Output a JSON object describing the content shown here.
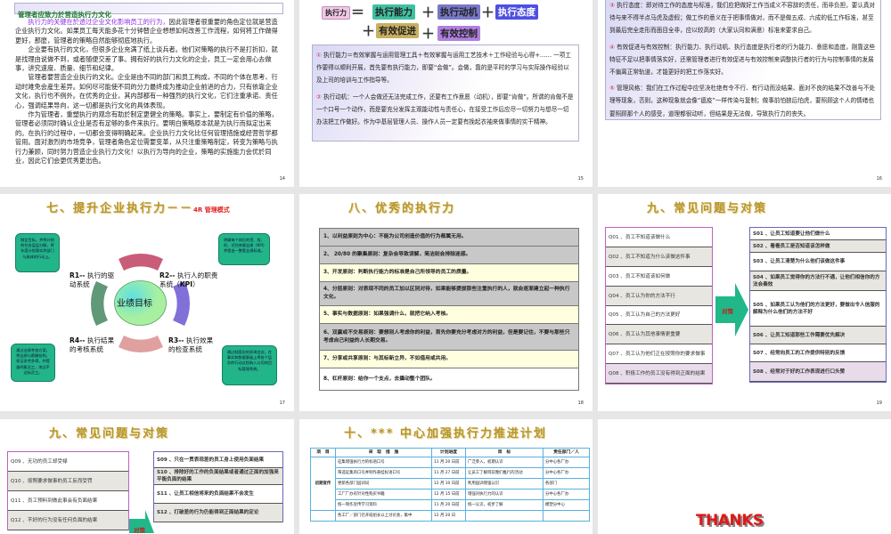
{
  "slides": {
    "s14": {
      "header": "管理者应致力於营造执行力文化",
      "p1_highlight": "执行力的关键在於透过企业文化影响员工的行为，",
      "p1_rest": "因此管理者很重要的角色定位就是营造企业执行力文化。如果员工每天能多花十分钟替企业想想如何改善工作流程，如何将工作做得更好，那麽，管理者的策略自然能够彻底地执行。",
      "p2": "企业要有执行的文化，但很多企业充满了纸上谈兵者。他们对策略的执行不是打折扣，就是找理由说做不到，或者随便交差了事。拥有好的执行力文化的企业，员工一定会用心去做事，讲究速度、质量、细节和纪律。",
      "p3": "管理者要营造企业执行的文化。企业是由不同的部门和员工构成，不同的个体在思考、行动时难免会産生差异。如何尽可能使不同的分力最终成为推动企业前进的合力，只有依靠企业文化，执行也不例外。在优秀的企业，其内部都有一种强烈的执行文化，它们注重承诺、责任心，强调结果导向，这一切都是执行文化的具体表现。",
      "p4": "作为管理者，重塑执行的观念有助於制定更健全的策略。事实上，要制定有价值的策略，管理者必须同时确认企业是否有足够的条件来执行。要明白策略原本就是为执行而拟定出来的。在执行的过程中，一切都会变得明确起来。企业执行力文化比任何管理措施或经营哲学都管用。面对激烈的市场竞争，管理者角色定位需要变革，从只注重策略制定，转变为策略与执行力兼顾，同时努力营造企业执行力文化！以执行为导向的企业，策略的实施能力会优於同业，因此它们会更优秀更出色。",
      "page": "14"
    },
    "s15": {
      "formula": {
        "lhs": "执行力",
        "eq": "＝",
        "plus": "＋",
        "terms": [
          "执行能力",
          "执行动机",
          "执行态度",
          "有效促进",
          "有效控制"
        ]
      },
      "items": [
        {
          "num": "①",
          "text": "执行能力＝有效掌握与运用管理工具＋有效掌握与运用工艺技术＋工作经验与心得+…… 一项工作要得以顺利开展，首先要有执行能力，即要“会做”。会做，靠的是平时的学习与实际操作经验以及上司的培训与工作指导等。"
        },
        {
          "num": "②",
          "text": "执行动机：一个人会做还无法完成工作，还要有工作意愿（动机），即要“肯做”。所谓的肯做不是一个口号一个动作，而是要充分发挥主观能动性与责任心，在接受工作后应尽一切努力与想尽一切办法把工作做好。作为中基层管理人员、操作人员一定要有挽起衣袖来做事情的实干精神。"
        }
      ],
      "page": "15"
    },
    "s16": {
      "items": [
        {
          "num": "③",
          "text": "执行态度：即对待工作的态度与标准，我们应把做好工作当成义不容辞的责任，而非负担，要认真对待与来不得半点马虎及虚假；做工作的意义在于把事情做对，而不是做五成、六成的低工作标准，甚至到最后完全走形而面目全非，应以较高的（大家认同和满意）标准来要求自己。"
        },
        {
          "num": "④",
          "text": "有效促进与有效控制：执行能力、执行动机、执行态度是执行者的行为能力、意愿和态度，刚靠这些特征不足以把事情落实好，还需管理者进行有效促进与有效控制来调整执行者的行为与控制事情的发展不偏离正常轨道，才能更好的把工作落实好。"
        },
        {
          "num": "⑤",
          "text": "管理风格：我们在工作过程中应坚决杜绝有令不行、有行动而没结果、面对不良的结果不改善与不处理等现象，否则，这种现象就会像“瘟疫”一样传染与复制；做事前怕狼后怕虎，要照顾这个人的情绪也要照顾那个人的感受，道理都很动听，但结果是无法做，导致执行力的丧失。"
        }
      ],
      "page": "16"
    },
    "s17": {
      "title": "七、提升企业执行力－－",
      "title_suffix": "4R 管理模式",
      "center": "业绩目标",
      "r1": {
        "code": "R1--",
        "label": " 执行的驱动系统",
        "note": "制定目标，并将计划的任务层层分解，将年度计划落实到部门与具体的行动上。"
      },
      "r2": {
        "code": "R2--",
        "label": " 执行人的职责系统（",
        "kpi": "KPI",
        "end": "）",
        "note": "明确每个岗位的责、权、利，识别关键业绩（KPI）并提出一整套业绩标准。"
      },
      "r3": {
        "code": "R3--",
        "label": " 执行效果的检查系统",
        "note": "通过制度化的质询会议，在事实和数据基础上将各个层次的行动过程纳入公司的目标管理系统。"
      },
      "r4": {
        "code": "R4--",
        "label": " 执行结果的考核系统",
        "note": "通过业绩考核方案，将业绩与薪酬挂钩，保证多劳多得，并提拔明星员工，淘汰不达标员工。"
      },
      "colors": {
        "ring1": "#c04060",
        "ring2": "#6a6ae0",
        "ring3": "#d05050",
        "ring4": "#509070",
        "center": "#a8f0a0",
        "bubble": "#22b58a"
      },
      "page": "17"
    },
    "s18": {
      "title": "八、优秀的执行力",
      "rows": [
        "1、以利益原则为中心：不能为公司创造价值的行为都属无用。",
        "2、 20/80 的聚集原则：复杂会导致误解，简洁则会排除迷惑。",
        "3、开发原则：判断执行能力的标准是自己所领导的员工的质量。",
        "4、分层原则：对表现不同的员工加以区别对待，如果能够提拔那些注重执行的人，就会逐渐建立起一种执行文化。",
        "5、事实与数据原则：如果强调什么，就把它纳入考核。",
        "6、双赢或不交易原则：要想别人考虑你的利益，首先你要充分考虑对方的利益，但是要记住，不要与那些只考虑自己利益的人长期交易。",
        "7、分享或共享原则：与其标新立异，不如借用或共用。",
        "8、杠杆原则：给你一个支点，去撬动整个团队。"
      ],
      "page": "18"
    },
    "s19": {
      "title": "九、常见问题与对策",
      "arrow_label": "对策",
      "questions": [
        "Q01 、员工不知道该做什么",
        "Q02 、员工不知道为什么该做这件事",
        "Q03 、员工不知道该如何做",
        "Q04 、员工认为你的方法不行",
        "Q05 、员工认为自己的方法更好",
        "Q06 、员工认为其他事情更重要",
        "Q07 、员工认为他们正在按照你的要求做事",
        "Q08 、积极工作的员工没有得到正面的结果"
      ],
      "solutions": [
        "S01 、让员工知道要让他们做什么",
        "S02 、看看员工是否知道该怎样做",
        "S03 、让员工清楚为什么他们该做这件事",
        "S04 、如果员工觉得你的方法行不通，让他们相信你的方法会奏效",
        "S05 、如果员工认为他们的方法更好，要做出令人信服的解释为什么他们的方法不好",
        "S06 、让员工知道那些工作需要优先解决",
        "S07 、经常向员工的工作提供特别的反馈",
        "S08 、经常对于好的工作表现进行口头赞"
      ],
      "page": "19"
    },
    "s20": {
      "title": "九、常见问题与对策",
      "arrow_label": "对策",
      "questions": [
        "Q09 、无功的员工却受禄",
        "Q10 、按照要求做事的员工反而受罚",
        "Q11 、员工预料到做此事会有负面结果",
        "Q12 、不好的行为没有任何负面的结果"
      ],
      "solutions": [
        "S09 、只在一贯表现差的员工身上使用负面结果",
        "S10 、排除好的工作的负面结果或者通过正面的加强来平衡负面的结果",
        "S11 、让员工相信将来的负面结果不会发生",
        "S12 、打破差的行为仍能得到正面结果的定论"
      ]
    },
    "s21": {
      "title": "十、*** 中心加强执行力推进计划",
      "headers": [
        "项　目",
        "采　取　措　施",
        "计划进度",
        "目　标",
        "责任部门／人"
      ],
      "group": "初期宣传",
      "rows": [
        [
          "征集增强执行力的标语口号",
          "11 月 20 日前",
          "广泛参入，初期认识",
          "分中心各厂办"
        ],
        [
          "筛选征集的口号并制作悬挂标语口号",
          "11 月 27 日前",
          "让员工了解目前我们推行的活动",
          "分中心各厂办"
        ],
        [
          "更新各部门园训词",
          "12 月 10 日前",
          "利用园训增强认识",
          "各部门"
        ],
        [
          "工厂厂办有针对性购买书籍",
          "12 月 15 日前",
          "增强对执行力的认识",
          "分中心各厂办"
        ],
        [
          "统一制作宣传学习资料",
          "11 月 20 日前",
          "统一认识，初步了解",
          "模塑分中心"
        ],
        [
          "各工厂／部门召开班组长以上讨论会，集中",
          "12 月 20 日",
          "",
          ""
        ]
      ]
    },
    "s22": {
      "thanks": "THANKS"
    }
  }
}
